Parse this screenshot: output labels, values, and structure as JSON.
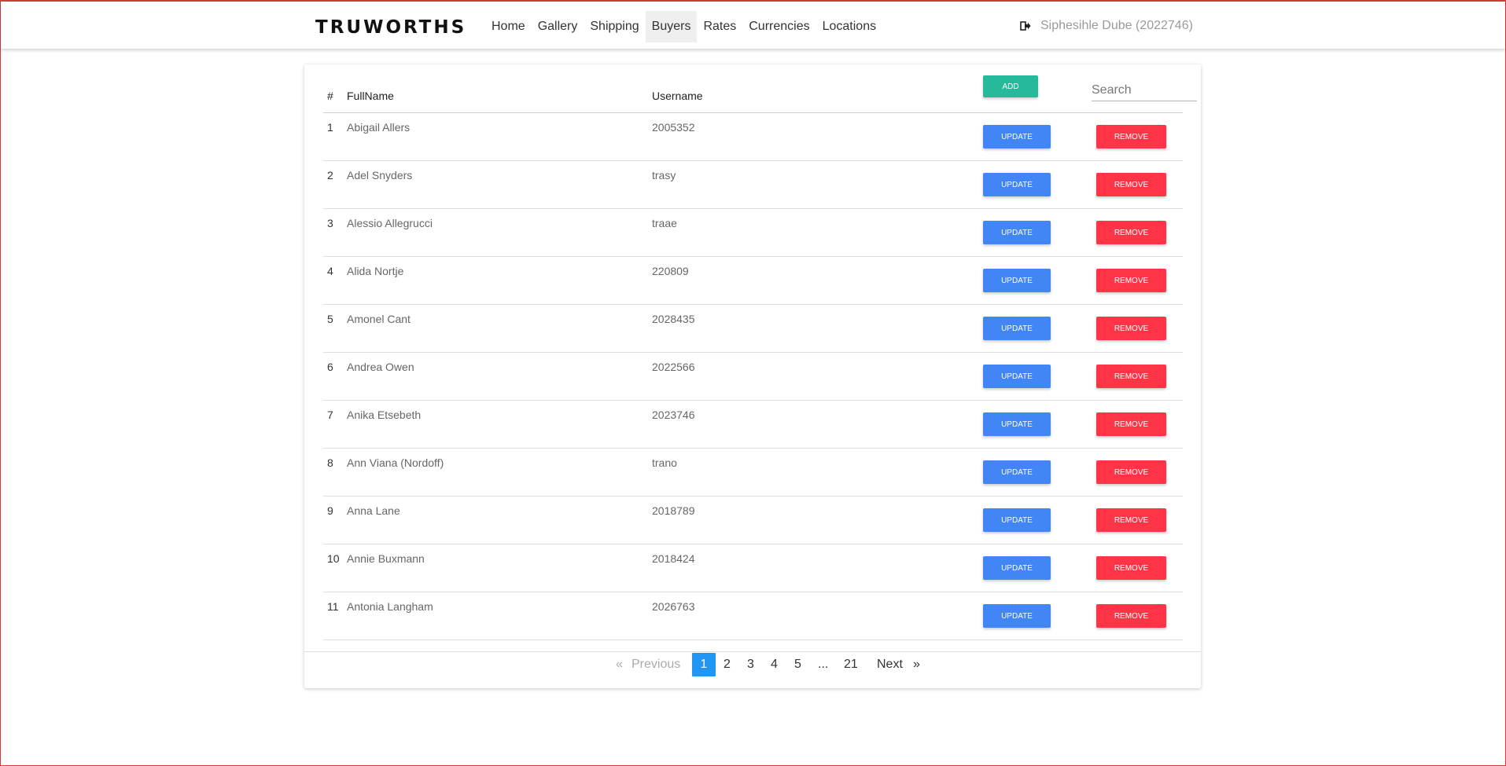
{
  "brand": "TRUWORTHS",
  "nav": [
    "Home",
    "Gallery",
    "Shipping",
    "Buyers",
    "Rates",
    "Currencies",
    "Locations"
  ],
  "active_nav": "Buyers",
  "user": {
    "name": "Siphesihle Dube (2022746)",
    "icon": "logout-icon"
  },
  "table": {
    "headers": {
      "num": "#",
      "full": "FullName",
      "user": "Username"
    },
    "add_label": "ADD",
    "search_placeholder": "Search",
    "update_label": "UPDATE",
    "remove_label": "REMOVE",
    "rows": [
      {
        "num": "1",
        "full": "Abigail Allers",
        "user": "2005352"
      },
      {
        "num": "2",
        "full": "Adel Snyders",
        "user": "trasy"
      },
      {
        "num": "3",
        "full": "Alessio Allegrucci",
        "user": "traae"
      },
      {
        "num": "4",
        "full": "Alida Nortje",
        "user": "220809"
      },
      {
        "num": "5",
        "full": "Amonel Cant",
        "user": "2028435"
      },
      {
        "num": "6",
        "full": "Andrea Owen",
        "user": "2022566"
      },
      {
        "num": "7",
        "full": "Anika Etsebeth",
        "user": "2023746"
      },
      {
        "num": "8",
        "full": "Ann Viana (Nordoff)",
        "user": "trano"
      },
      {
        "num": "9",
        "full": "Anna Lane",
        "user": "2018789"
      },
      {
        "num": "10",
        "full": "Annie Buxmann",
        "user": "2018424"
      },
      {
        "num": "11",
        "full": "Antonia Langham",
        "user": "2026763"
      }
    ]
  },
  "pagination": {
    "prev_arrow": "«",
    "prev": "Previous",
    "pages": [
      "1",
      "2",
      "3",
      "4",
      "5",
      "...",
      "21"
    ],
    "active": "1",
    "next": "Next",
    "next_arrow": "»"
  },
  "colors": {
    "add": "#26b99a",
    "update": "#4285f4",
    "remove": "#ff3547",
    "active_page": "#2196f3"
  }
}
